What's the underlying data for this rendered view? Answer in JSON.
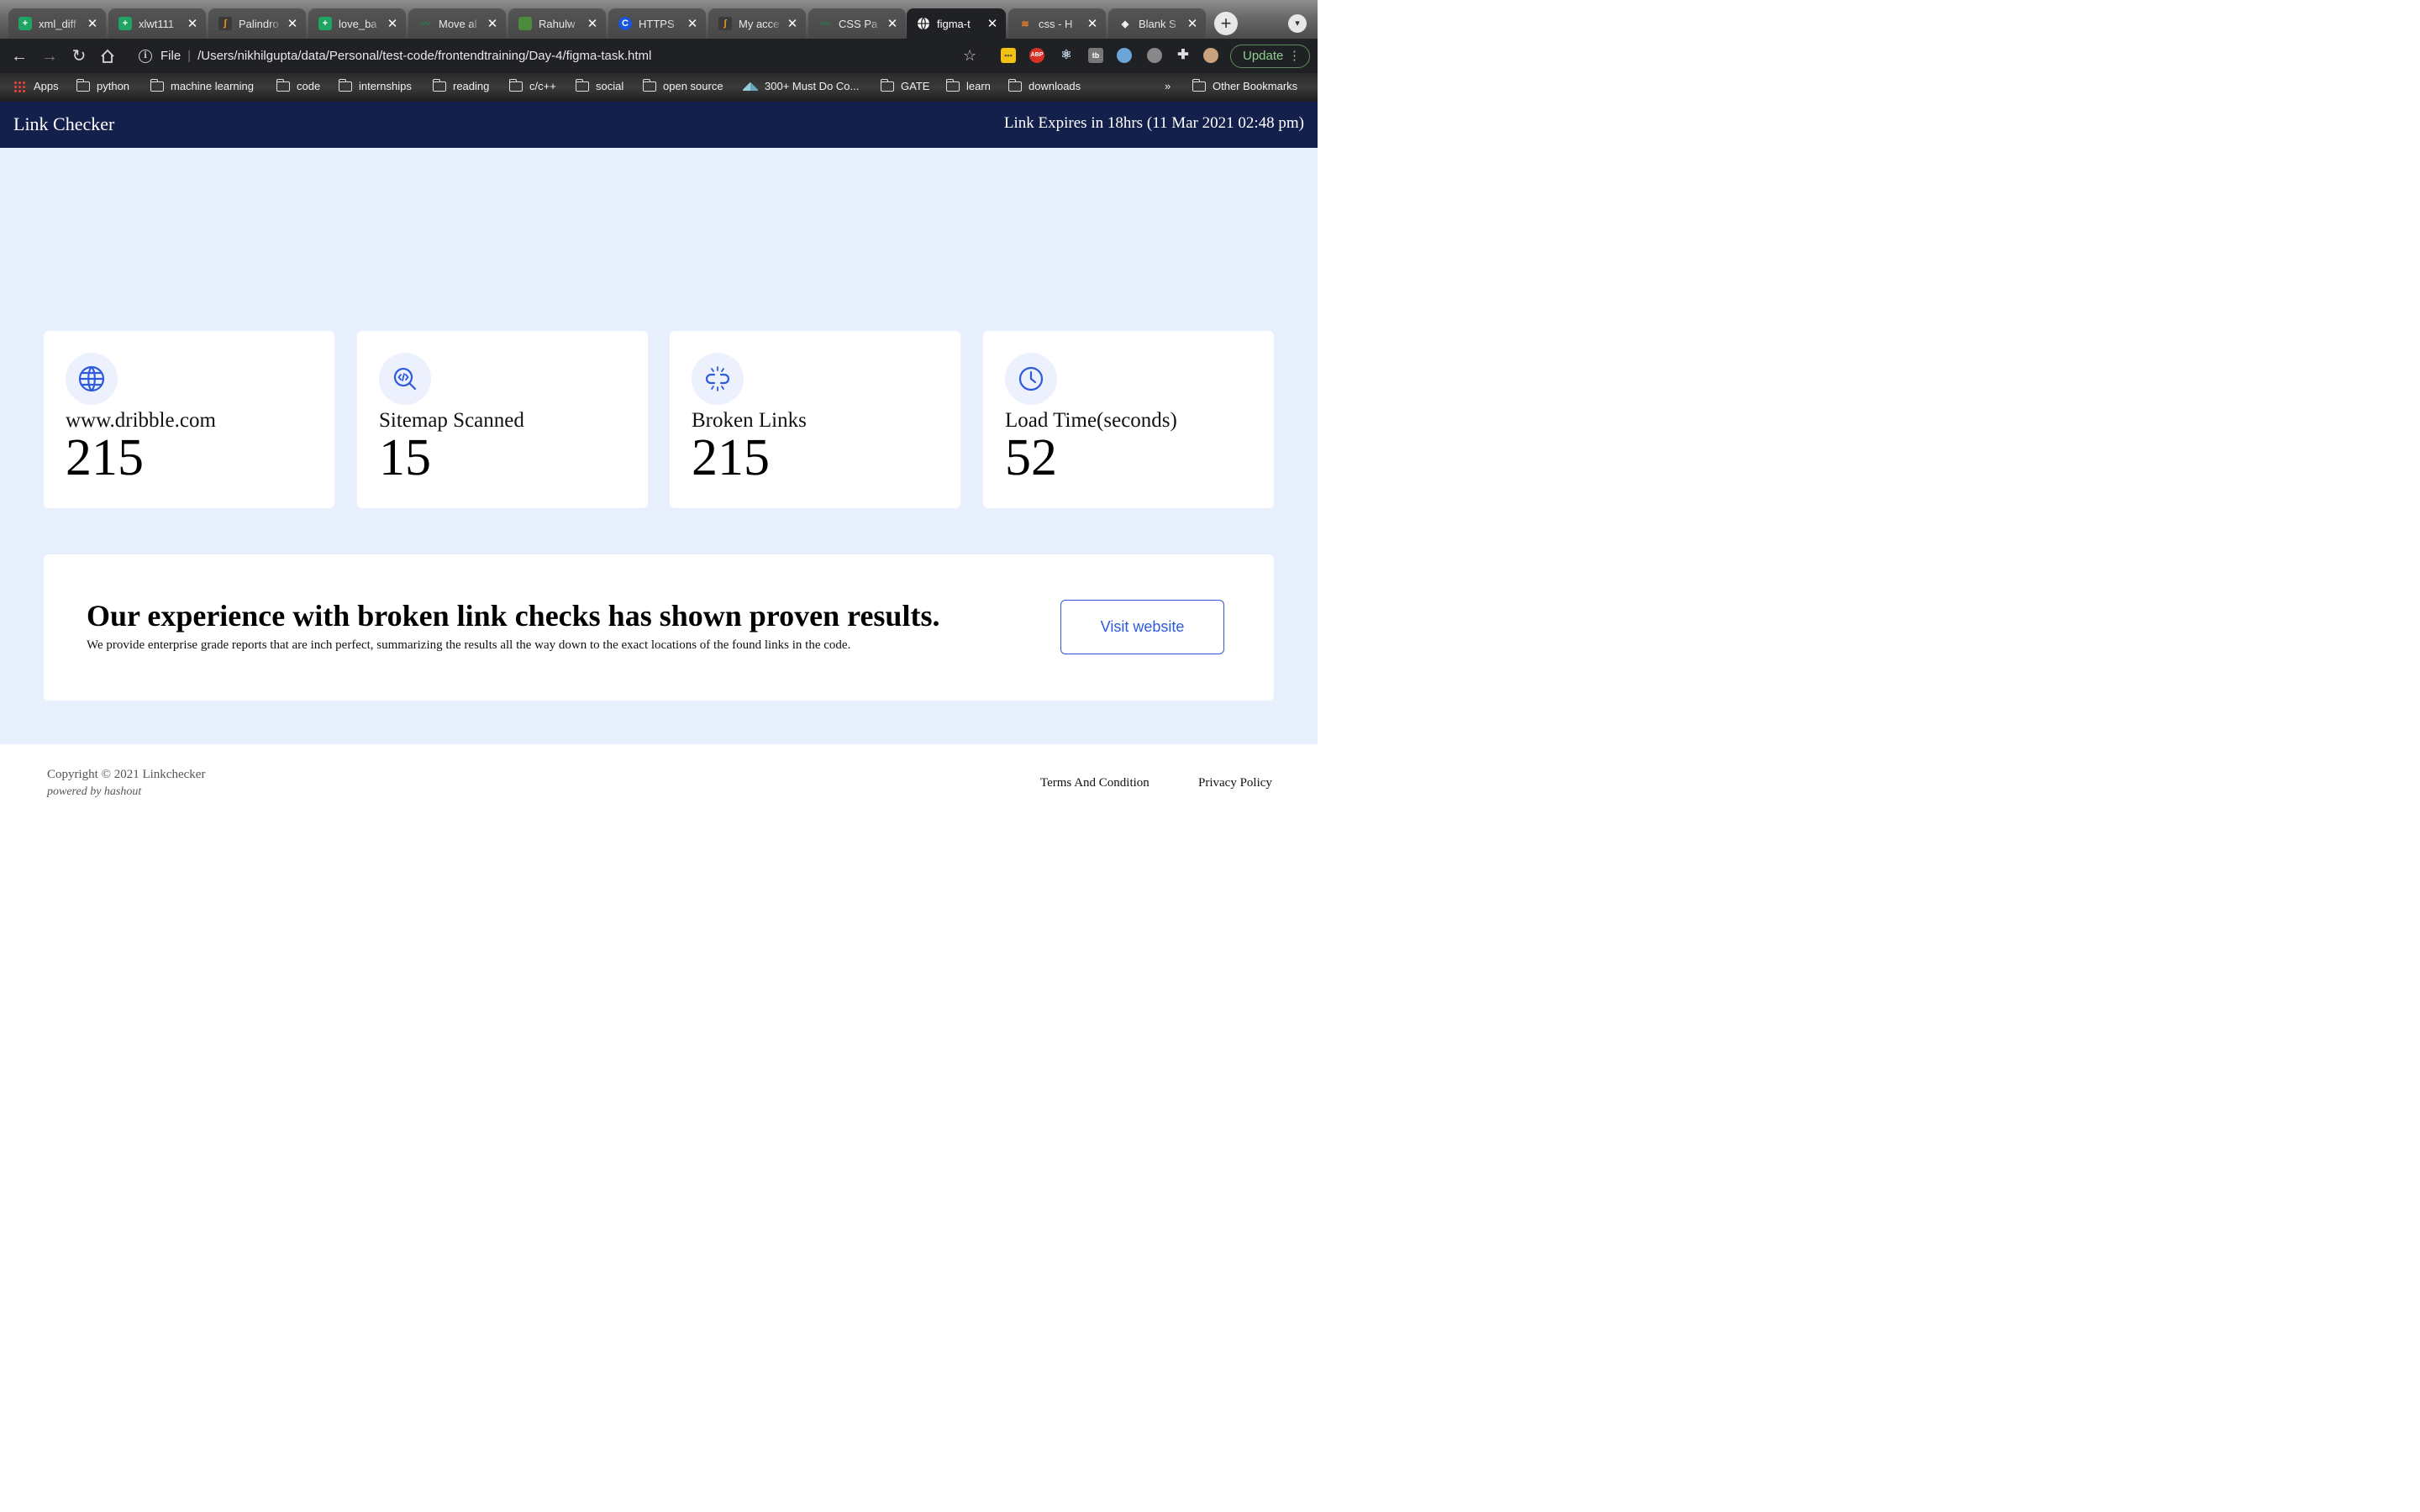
{
  "browser": {
    "tabs": [
      {
        "title": "xml_diff",
        "icon": "sheets-icon",
        "color": "#1fa463"
      },
      {
        "title": "xlwt111",
        "icon": "sheets-icon",
        "color": "#1fa463"
      },
      {
        "title": "Palindro",
        "icon": "leetcode-icon",
        "color": "#f29a1f"
      },
      {
        "title": "love_ba",
        "icon": "sheets-icon",
        "color": "#1fa463"
      },
      {
        "title": "Move al",
        "icon": "codepen-leaf-icon",
        "color": "#2a7d4f"
      },
      {
        "title": "Rahulw",
        "icon": "leaf-icon",
        "color": "#4c8a3c"
      },
      {
        "title": "HTTPS",
        "icon": "c-icon",
        "color": "#1a56db"
      },
      {
        "title": "My acce",
        "icon": "leetcode-icon",
        "color": "#f29a1f"
      },
      {
        "title": "CSS Pa",
        "icon": "codepen-leaf-icon",
        "color": "#2a7d4f"
      },
      {
        "title": "figma-t",
        "icon": "globe-icon",
        "color": "#ffffff"
      },
      {
        "title": "css - H",
        "icon": "stackoverflow-icon",
        "color": "#f48024"
      },
      {
        "title": "Blank S",
        "icon": "codepen-icon",
        "color": "#ffffff"
      }
    ],
    "active_tab_index": 9,
    "address": {
      "scheme_label": "File",
      "url": "/Users/nikhilgupta/data/Personal/test-code/frontendtraining/Day-4/figma-task.html"
    },
    "extensions": {
      "abp_label": "ABP",
      "tb_label": "tb"
    },
    "update_label": "Update",
    "bookmarks": [
      {
        "label": "Apps",
        "type": "apps"
      },
      {
        "label": "python",
        "type": "folder"
      },
      {
        "label": "machine learning",
        "type": "folder"
      },
      {
        "label": "code",
        "type": "folder"
      },
      {
        "label": "internships",
        "type": "folder"
      },
      {
        "label": "reading",
        "type": "folder"
      },
      {
        "label": "c/c++",
        "type": "folder"
      },
      {
        "label": "social",
        "type": "folder"
      },
      {
        "label": "open source",
        "type": "folder"
      },
      {
        "label": "300+ Must Do Co...",
        "type": "link"
      },
      {
        "label": "GATE",
        "type": "folder"
      },
      {
        "label": "learn",
        "type": "folder"
      },
      {
        "label": "downloads",
        "type": "folder"
      }
    ],
    "bookmarks_overflow": "»",
    "other_bookmarks": "Other Bookmarks"
  },
  "header": {
    "brand": "Link Checker",
    "expiry": "Link Expires in 18hrs (11 Mar 2021 02:48 pm)"
  },
  "stats": [
    {
      "label": "www.dribble.com",
      "value": "215",
      "icon": "globe-icon"
    },
    {
      "label": "Sitemap Scanned",
      "value": "15",
      "icon": "code-search-icon"
    },
    {
      "label": "Broken Links",
      "value": "215",
      "icon": "broken-link-icon"
    },
    {
      "label": "Load Time(seconds)",
      "value": "52",
      "icon": "clock-icon"
    }
  ],
  "cta": {
    "title": "Our experience with broken link checks has shown proven results.",
    "description": "We provide enterprise grade reports that are inch perfect, summarizing the results all the way down to the exact locations of the found links in the code.",
    "button": "Visit website"
  },
  "footer": {
    "copyright": "Copyright © 2021 Linkchecker",
    "powered": "powered by hashout",
    "links": [
      "Terms And Condition",
      "Privacy Policy"
    ]
  },
  "colors": {
    "header_bg": "#13204b",
    "page_bg": "#e9f0fd",
    "accent": "#2e5bdc"
  }
}
